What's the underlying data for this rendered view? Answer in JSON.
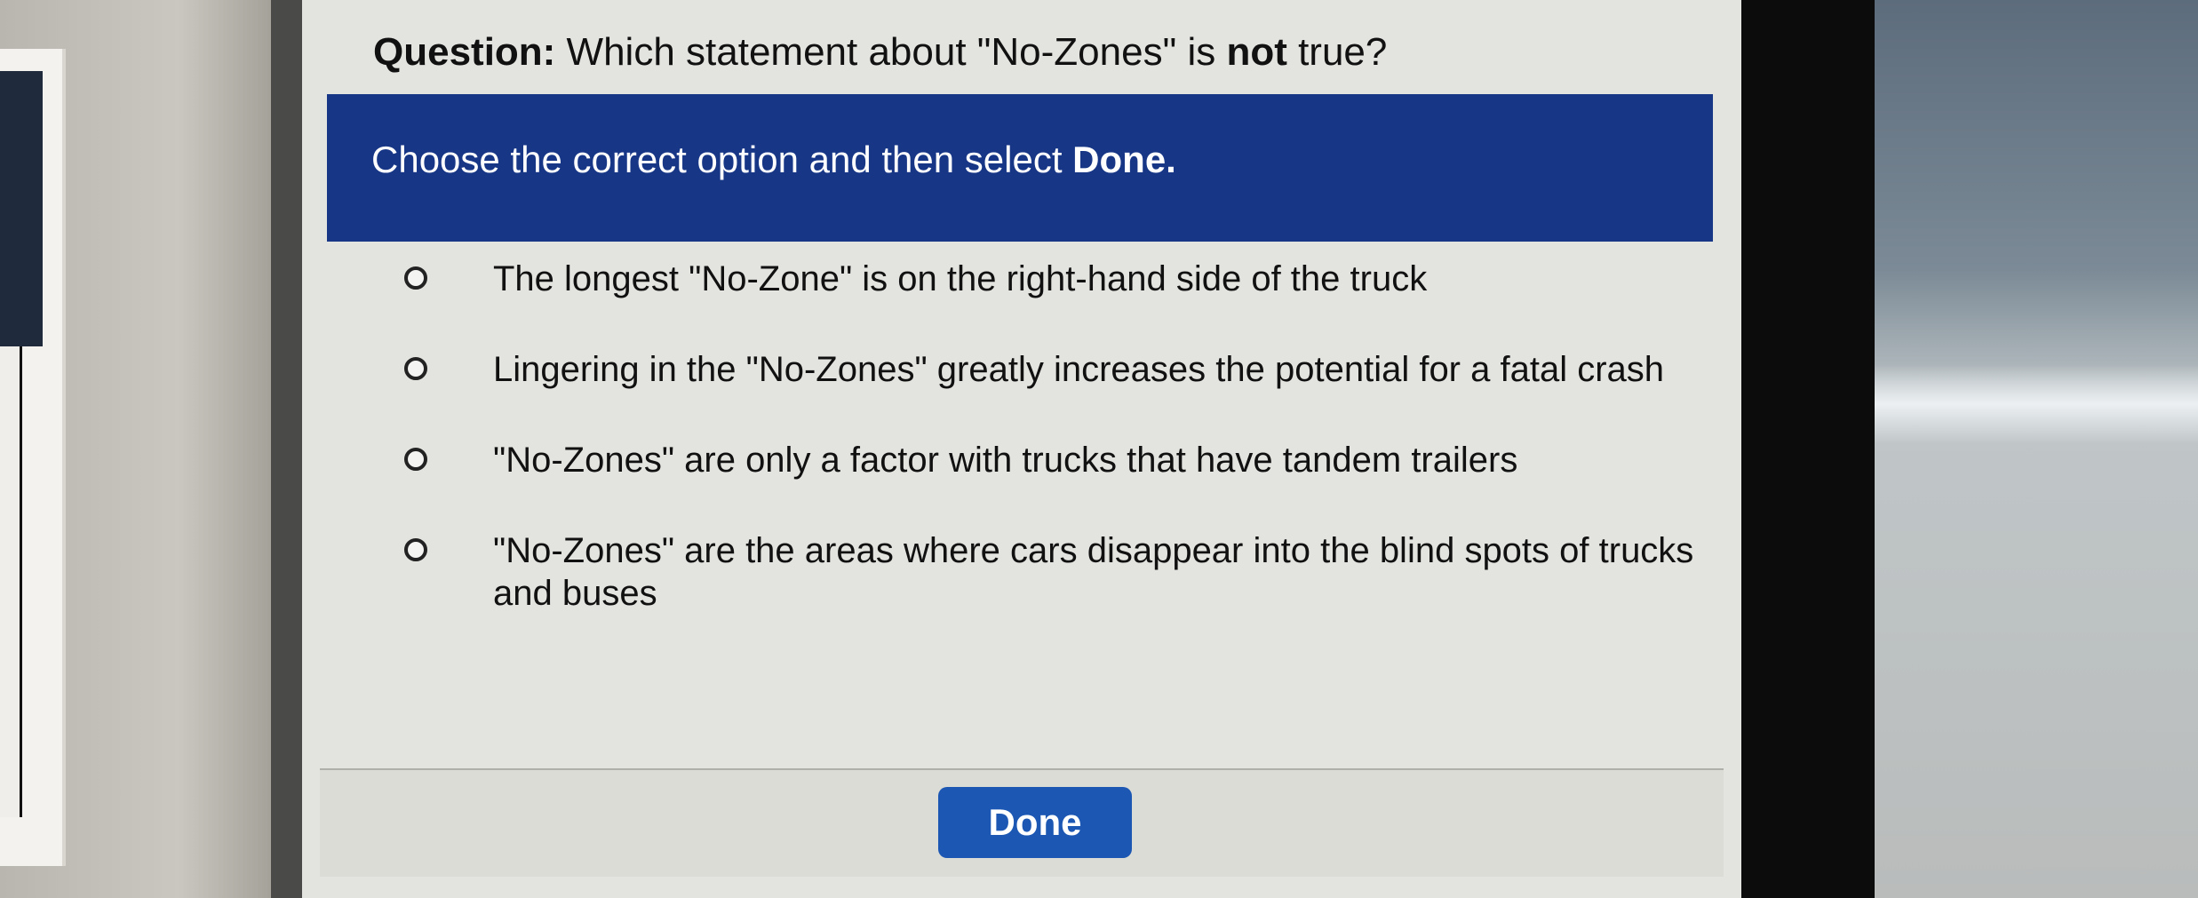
{
  "question": {
    "label": "Question:",
    "text_before": " Which statement about \"No-Zones\" is ",
    "emphasis": "not",
    "text_after": " true?"
  },
  "instruction": {
    "text": "Choose the correct option and then select ",
    "emphasis": "Done."
  },
  "options": [
    {
      "label": "The longest \"No-Zone\" is on the right-hand side of the truck",
      "selected": false
    },
    {
      "label": "Lingering in the \"No-Zones\" greatly increases the potential for a fatal crash",
      "selected": false
    },
    {
      "label": "\"No-Zones\" are only a factor with trucks that have tandem trailers",
      "selected": false
    },
    {
      "label": "\"No-Zones\" are the areas where cars disappear into the blind spots of trucks and buses",
      "selected": false
    }
  ],
  "actions": {
    "done_label": "Done"
  },
  "colors": {
    "banner": "#173686",
    "done_button": "#1b57b3",
    "screen_bg": "#e3e3df"
  }
}
